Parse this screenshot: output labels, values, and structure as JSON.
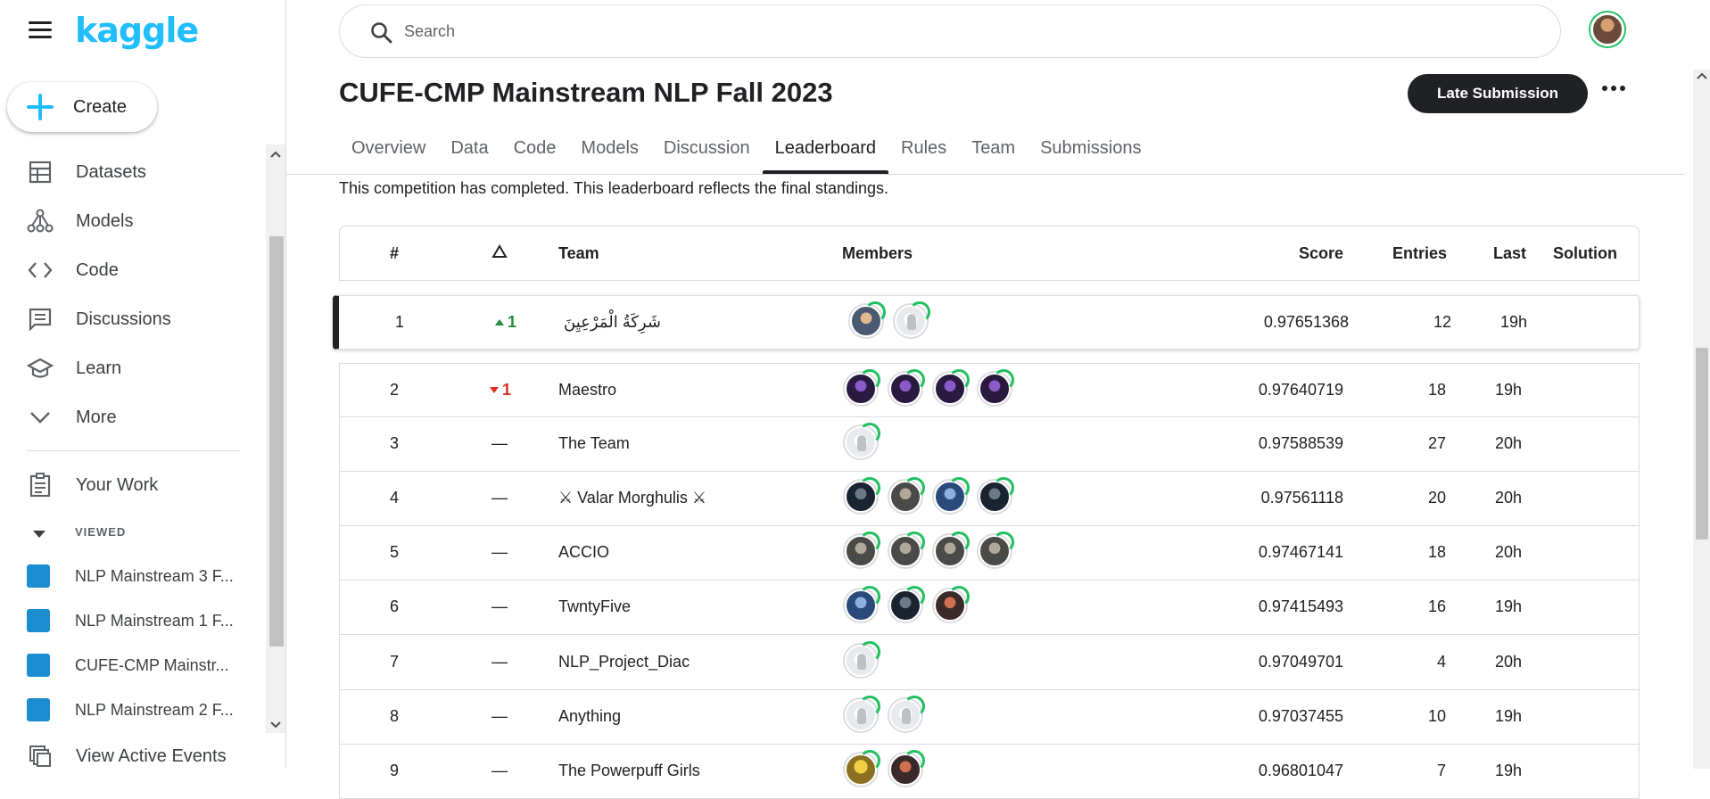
{
  "brand": {
    "logo": "kaggle",
    "accent": "#20beff"
  },
  "sidebar": {
    "create_label": "Create",
    "items": [
      {
        "label": "Datasets",
        "icon": "table-icon"
      },
      {
        "label": "Models",
        "icon": "models-icon"
      },
      {
        "label": "Code",
        "icon": "code-icon"
      },
      {
        "label": "Discussions",
        "icon": "discussion-icon"
      },
      {
        "label": "Learn",
        "icon": "learn-icon"
      },
      {
        "label": "More",
        "icon": "chevron-down-icon"
      }
    ],
    "your_work": "Your Work",
    "viewed_header": "VIEWED",
    "viewed": [
      "NLP Mainstream 3 F...",
      "NLP Mainstream 1 F...",
      "CUFE-CMP Mainstr...",
      "NLP Mainstream 2 F..."
    ],
    "view_events": "View Active Events"
  },
  "search": {
    "placeholder": "Search"
  },
  "competition": {
    "title": "CUFE-CMP Mainstream NLP Fall 2023",
    "late_submission": "Late Submission",
    "notice": "This competition has completed. This leaderboard reflects the final standings."
  },
  "tabs": [
    "Overview",
    "Data",
    "Code",
    "Models",
    "Discussion",
    "Leaderboard",
    "Rules",
    "Team",
    "Submissions"
  ],
  "active_tab": "Leaderboard",
  "leaderboard": {
    "headers": {
      "rank": "#",
      "team": "Team",
      "members": "Members",
      "score": "Score",
      "entries": "Entries",
      "last": "Last",
      "solution": "Solution"
    },
    "rows": [
      {
        "rank": "1",
        "change": "1",
        "dir": "up",
        "team": "شَرِكَةُ الْمَرْعِيِنَ",
        "members": [
          "photo",
          "goose"
        ],
        "score": "0.97651368",
        "entries": "12",
        "last": "19h"
      },
      {
        "rank": "2",
        "change": "1",
        "dir": "down",
        "team": "Maestro",
        "members": [
          "purple",
          "purple",
          "purple",
          "purple"
        ],
        "score": "0.97640719",
        "entries": "18",
        "last": "19h"
      },
      {
        "rank": "3",
        "change": "—",
        "dir": "none",
        "team": "The Team",
        "members": [
          "goose"
        ],
        "score": "0.97588539",
        "entries": "27",
        "last": "20h"
      },
      {
        "rank": "4",
        "change": "—",
        "dir": "none",
        "team": "⚔ Valar Morghulis ⚔",
        "members": [
          "dark",
          "gray",
          "blue",
          "dark"
        ],
        "score": "0.97561118",
        "entries": "20",
        "last": "20h"
      },
      {
        "rank": "5",
        "change": "—",
        "dir": "none",
        "team": "ACCIO",
        "members": [
          "gray",
          "gray",
          "gray",
          "gray"
        ],
        "score": "0.97467141",
        "entries": "18",
        "last": "20h"
      },
      {
        "rank": "6",
        "change": "—",
        "dir": "none",
        "team": "TwntyFive",
        "members": [
          "blue",
          "dark",
          "red"
        ],
        "score": "0.97415493",
        "entries": "16",
        "last": "19h"
      },
      {
        "rank": "7",
        "change": "—",
        "dir": "none",
        "team": "NLP_Project_Diac",
        "members": [
          "goose"
        ],
        "score": "0.97049701",
        "entries": "4",
        "last": "20h"
      },
      {
        "rank": "8",
        "change": "—",
        "dir": "none",
        "team": "Anything",
        "members": [
          "goose",
          "goose"
        ],
        "score": "0.97037455",
        "entries": "10",
        "last": "19h"
      },
      {
        "rank": "9",
        "change": "—",
        "dir": "none",
        "team": "The Powerpuff Girls",
        "members": [
          "yellow",
          "red"
        ],
        "score": "0.96801047",
        "entries": "7",
        "last": "19h"
      }
    ]
  }
}
